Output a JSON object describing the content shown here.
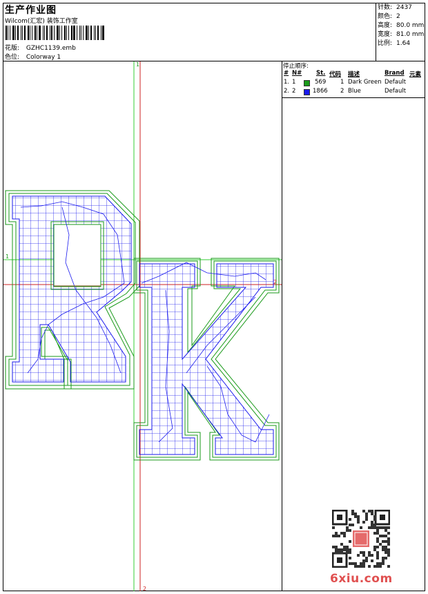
{
  "header": {
    "title": "生产作业图",
    "studio": "Wilcom(汇宏) 装饰工作室",
    "design_label": "花版:",
    "design_value": "GZHC1139.emb",
    "colorway_label": "色位:",
    "colorway_value": "Colorway 1"
  },
  "stats": [
    {
      "label": "针数:",
      "value": "2437"
    },
    {
      "label": "颜色:",
      "value": "2"
    },
    {
      "label": "高度:",
      "value": "80.0 mm"
    },
    {
      "label": "宽度:",
      "value": "81.0 mm"
    },
    {
      "label": "比例:",
      "value": "1.64"
    }
  ],
  "stop_sequence": {
    "title": "停止顺序:",
    "columns": [
      "#",
      "N#",
      "St.",
      "代码",
      "描述",
      "Brand",
      "元素"
    ],
    "rows": [
      {
        "idx": "1.",
        "n": "1",
        "st": "569",
        "code": "1",
        "desc": "Dark Green",
        "brand": "Default",
        "color": "#1a9a1a"
      },
      {
        "idx": "2.",
        "n": "2",
        "st": "1866",
        "code": "2",
        "desc": "Blue",
        "brand": "Default",
        "color": "#1a1aee"
      }
    ]
  },
  "guides": {
    "h1_label": "1",
    "h2_label": "2",
    "v1_label": "1",
    "v2_label": "2"
  },
  "colors": {
    "fill_outline": "#1a9a1a",
    "stitch": "#1a1aee",
    "guide_green": "#33cc33",
    "guide_red": "#cc2222"
  },
  "watermark": {
    "site": "6xiu.com"
  }
}
